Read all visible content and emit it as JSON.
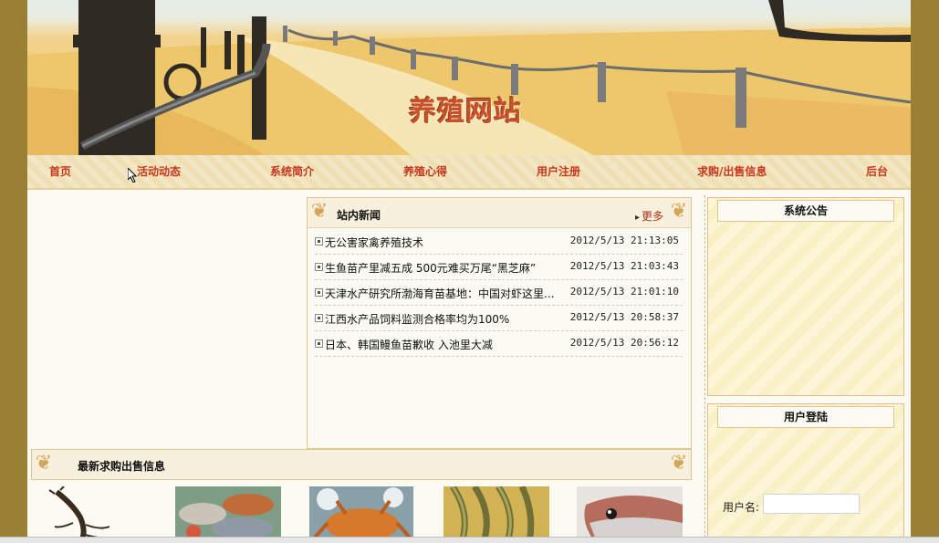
{
  "site_title": "养殖网站",
  "nav": [
    "首页",
    "活动动态",
    "系统简介",
    "养殖心得",
    "用户注册",
    "求购/出售信息",
    "后台"
  ],
  "news": {
    "title": "站内新闻",
    "more": "更多",
    "items": [
      {
        "title": "无公害家禽养殖技术",
        "date": "2012/5/13 21:13:05"
      },
      {
        "title": "生鱼苗产里减五成 500元难买万尾“黑芝麻”",
        "date": "2012/5/13 21:03:43"
      },
      {
        "title": "天津水产研究所渤海育苗基地：中国对虾这里...",
        "date": "2012/5/13 21:01:10"
      },
      {
        "title": "江西水产品饲料监测合格率均为100%",
        "date": "2012/5/13 20:58:37"
      },
      {
        "title": "日本、韩国鳗鱼苗歉收 入池里大减",
        "date": "2012/5/13 20:56:12"
      }
    ]
  },
  "announcement": {
    "title": "系统公告"
  },
  "login": {
    "title": "用户登陆",
    "username_label": "用户名:",
    "username_value": ""
  },
  "buy_sell": {
    "title": "最新求购出售信息"
  },
  "images": [
    "lobster-icon",
    "seafood-icon",
    "crab-icon",
    "eel-icon",
    "fish-icon"
  ]
}
